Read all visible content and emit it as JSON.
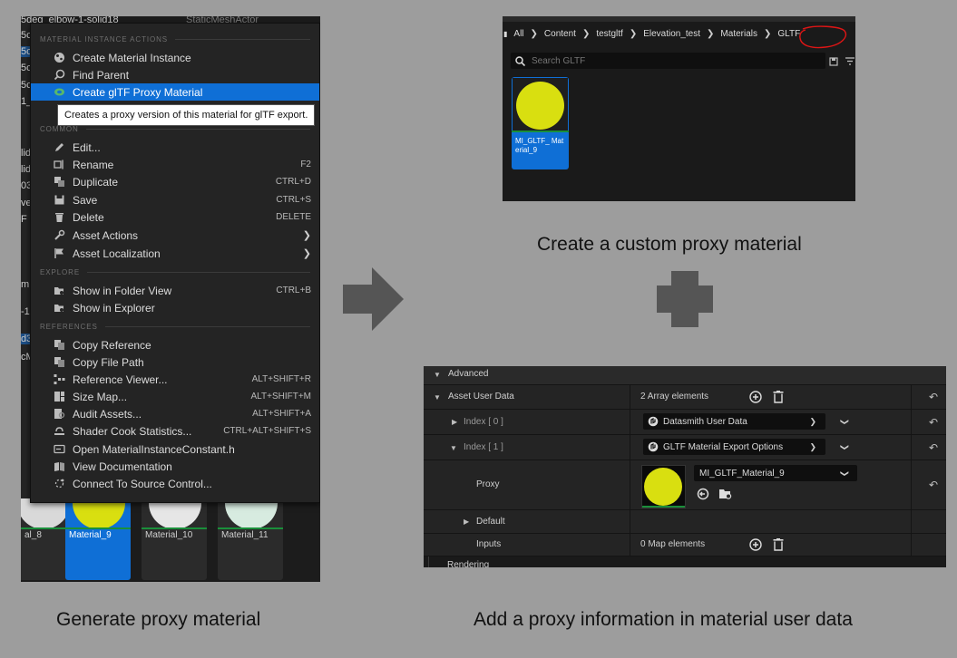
{
  "panel1": {
    "background_items": [
      "5deg_elbow-1-solid18",
      "StaticMeshActor",
      "5c",
      "5c",
      "5c",
      "5c",
      "1_",
      "lid",
      "lid",
      "03_",
      "ve",
      "F",
      "m",
      "-1",
      "d3",
      "cM"
    ],
    "menu": {
      "section_material_actions": "MATERIAL INSTANCE ACTIONS",
      "create_material_instance": "Create Material Instance",
      "find_parent": "Find Parent",
      "create_gltf_proxy": "Create glTF Proxy Material",
      "hidden_item_prefix": "D",
      "section_common": "COMMON",
      "edit": "Edit...",
      "rename": "Rename",
      "rename_sc": "F2",
      "duplicate": "Duplicate",
      "duplicate_sc": "CTRL+D",
      "save": "Save",
      "save_sc": "CTRL+S",
      "delete": "Delete",
      "delete_sc": "DELETE",
      "asset_actions": "Asset Actions",
      "asset_localization": "Asset Localization",
      "section_explore": "EXPLORE",
      "show_in_folder": "Show in Folder View",
      "show_in_folder_sc": "CTRL+B",
      "show_in_explorer": "Show in Explorer",
      "section_references": "REFERENCES",
      "copy_reference": "Copy Reference",
      "copy_file_path": "Copy File Path",
      "reference_viewer": "Reference Viewer...",
      "reference_viewer_sc": "ALT+SHIFT+R",
      "size_map": "Size Map...",
      "size_map_sc": "ALT+SHIFT+M",
      "audit_assets": "Audit Assets...",
      "audit_assets_sc": "ALT+SHIFT+A",
      "shader_cook": "Shader Cook Statistics...",
      "shader_cook_sc": "CTRL+ALT+SHIFT+S",
      "open_class": "Open MaterialInstanceConstant.h",
      "view_docs": "View Documentation",
      "connect_source": "Connect To Source Control..."
    },
    "tooltip": "Creates a proxy version of this material for glTF export.",
    "thumbnails": [
      "al_8",
      "Material_9",
      "Material_10",
      "Material_11"
    ]
  },
  "panel2": {
    "breadcrumbs": [
      "All",
      "Content",
      "testgltf",
      "Elevation_test",
      "Materials",
      "GLTF"
    ],
    "search_placeholder": "Search GLTF",
    "asset_name": "MI_GLTF_ Material_9"
  },
  "panel3": {
    "advanced": "Advanced",
    "asset_user_data": "Asset User Data",
    "array_count": "2 Array elements",
    "index0": "Index [ 0 ]",
    "index0_value": "Datasmith User Data",
    "index1": "Index [ 1 ]",
    "index1_value": "GLTF Material Export Options",
    "proxy": "Proxy",
    "proxy_value": "MI_GLTF_Material_9",
    "default": "Default",
    "inputs": "Inputs",
    "map_count": "0 Map elements",
    "cut_off_text": "Rendering"
  },
  "captions": {
    "generate": "Generate proxy material",
    "create_custom": "Create a custom proxy material",
    "add_info": "Add a proxy information in material user data"
  },
  "colors": {
    "highlight": "#0f6fd6",
    "material_yellow": "#d9df10",
    "red_annotation": "#e01515",
    "arrow_gray": "#555555"
  }
}
